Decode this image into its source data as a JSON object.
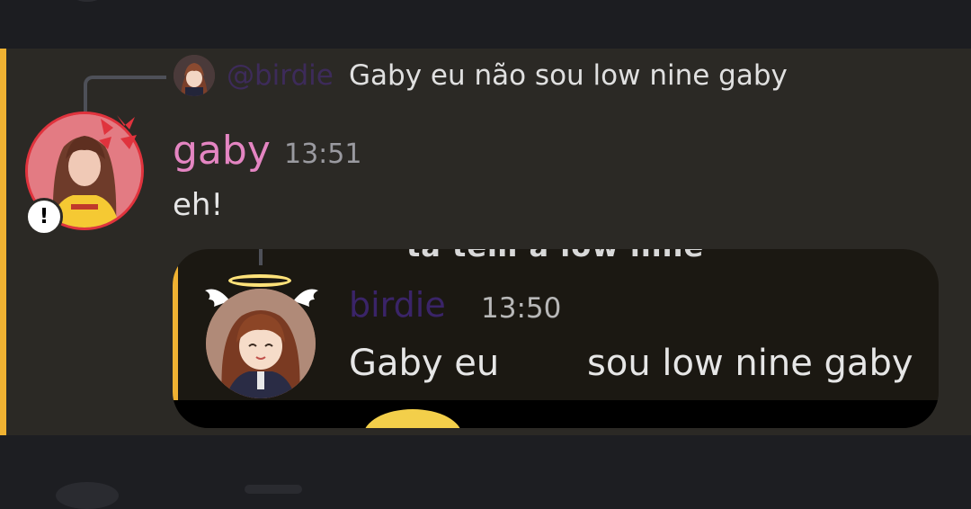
{
  "colors": {
    "background": "#2b2925",
    "mention_highlight": "#f0b232",
    "author_color": "#e485c2",
    "reply_author_color": "#3d2b5a"
  },
  "reply": {
    "author_mention": "@birdie",
    "preview_text": "Gaby eu não sou low nine gaby",
    "avatar_icon": "anime-girl-avatar"
  },
  "message": {
    "author": "gaby",
    "time": "13:51",
    "text": "eh!",
    "avatar_icon": "pink-profile-photo",
    "status_icon": "angry-vein-icon",
    "badge": "!"
  },
  "embed": {
    "author": "birdie",
    "time": "13:50",
    "text_part1": "Gaby eu",
    "text_part2": "sou low nine gaby",
    "avatar_icon": "angel-anime-avatar",
    "cut_off_text": "ta tem a low nine"
  }
}
